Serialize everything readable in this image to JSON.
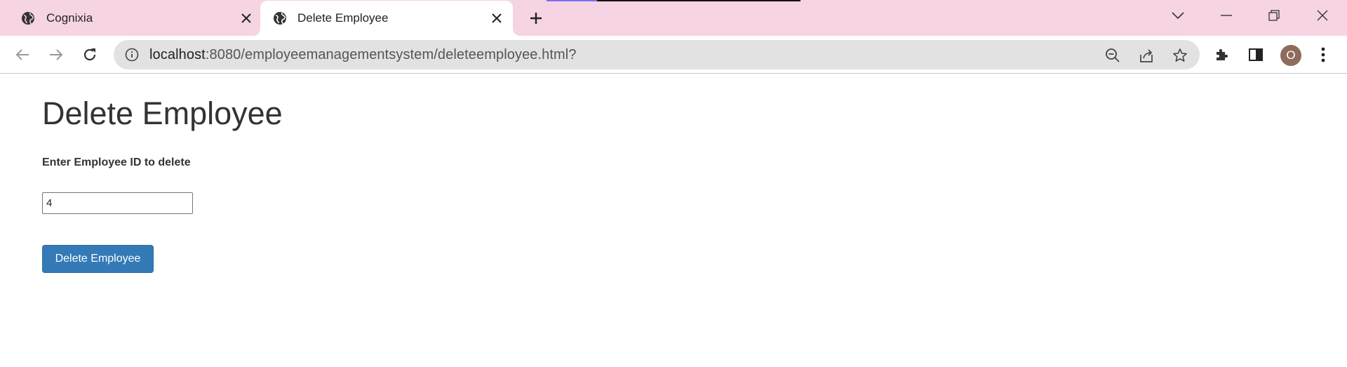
{
  "browser": {
    "tabs": [
      {
        "title": "Cognixia",
        "active": false,
        "favicon": "globe-icon"
      },
      {
        "title": "Delete Employee",
        "active": true,
        "favicon": "globe-icon"
      }
    ],
    "new_tab_icon": "plus-icon",
    "window_controls": [
      "tab-search-chevron-icon",
      "minimize-icon",
      "restore-icon",
      "close-icon"
    ],
    "address_bar": {
      "host": "localhost",
      "rest": ":8080/employeemanagementsystem/deleteemployee.html?"
    },
    "profile_initial": "O",
    "colors": {
      "tabstrip": "#f6d4e4",
      "omnibox": "#e2e2e2",
      "avatar": "#8d6b5d"
    }
  },
  "page": {
    "title": "Delete Employee",
    "label": "Enter Employee ID to delete",
    "input_value": "4",
    "button_label": "Delete Employee",
    "colors": {
      "button": "#337ab7",
      "text": "#333333"
    }
  }
}
